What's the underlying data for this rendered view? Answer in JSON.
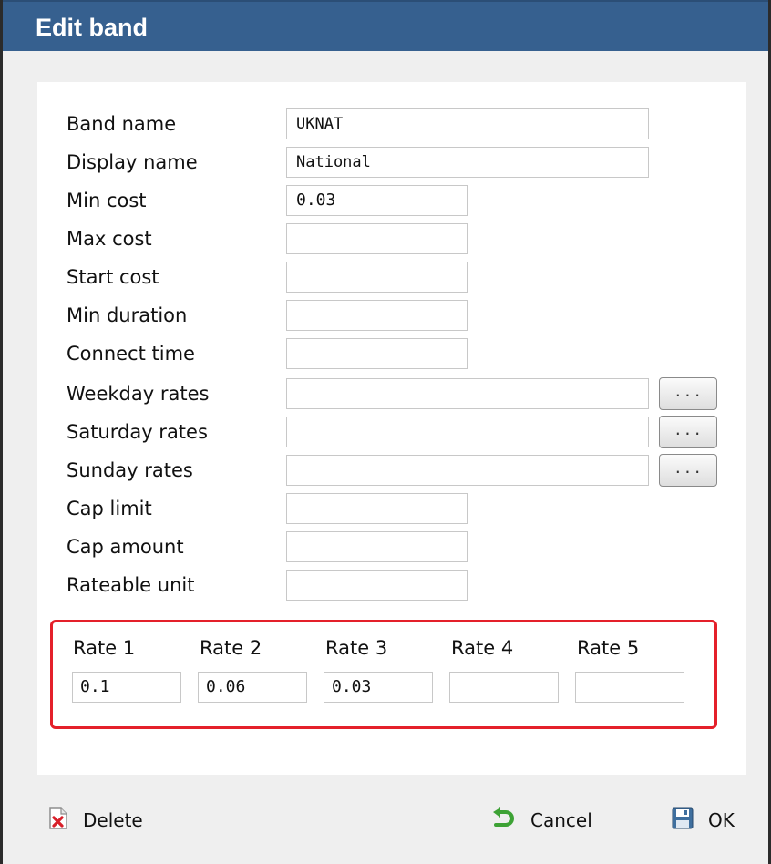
{
  "dialog": {
    "title": "Edit band"
  },
  "form": {
    "rows": [
      {
        "label": "Band name",
        "value": "UKNAT"
      },
      {
        "label": "Display name",
        "value": "National"
      },
      {
        "label": "Min cost",
        "value": "0.03"
      },
      {
        "label": "Max cost",
        "value": ""
      },
      {
        "label": "Start cost",
        "value": ""
      },
      {
        "label": "Min duration",
        "value": ""
      },
      {
        "label": "Connect time",
        "value": ""
      },
      {
        "label": "Weekday rates",
        "value": "",
        "button": "..."
      },
      {
        "label": "Saturday rates",
        "value": "",
        "button": "..."
      },
      {
        "label": "Sunday rates",
        "value": "",
        "button": "..."
      },
      {
        "label": "Cap limit",
        "value": ""
      },
      {
        "label": "Cap amount",
        "value": ""
      },
      {
        "label": "Rateable unit",
        "value": ""
      }
    ]
  },
  "rates": [
    {
      "label": "Rate 1",
      "value": "0.1"
    },
    {
      "label": "Rate 2",
      "value": "0.06"
    },
    {
      "label": "Rate 3",
      "value": "0.03"
    },
    {
      "label": "Rate 4",
      "value": ""
    },
    {
      "label": "Rate 5",
      "value": ""
    }
  ],
  "footer": {
    "delete_label": "Delete",
    "cancel_label": "Cancel",
    "ok_label": "OK",
    "delete_icon": "delete-icon",
    "cancel_icon": "undo-arrow-icon",
    "ok_icon": "floppy-disk-icon"
  },
  "colors": {
    "titlebar": "#36608f",
    "highlight_border": "#e4202a",
    "dialog_background": "#efefef"
  }
}
